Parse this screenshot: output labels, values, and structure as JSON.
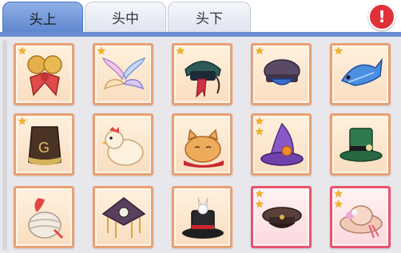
{
  "tabs": [
    {
      "label": "头上",
      "active": true
    },
    {
      "label": "头中",
      "active": false
    },
    {
      "label": "头下",
      "active": false
    }
  ],
  "alert_symbol": "!",
  "items": [
    {
      "icon": "bells-bow-icon",
      "stars": 1,
      "rarity": "normal"
    },
    {
      "icon": "angel-wings-icon",
      "stars": 1,
      "rarity": "normal"
    },
    {
      "icon": "chinese-hat-icon",
      "stars": 1,
      "rarity": "normal"
    },
    {
      "icon": "purple-cap-icon",
      "stars": 1,
      "rarity": "normal"
    },
    {
      "icon": "blue-fish-icon",
      "stars": 1,
      "rarity": "normal"
    },
    {
      "icon": "brown-fez-hat-icon",
      "stars": 1,
      "rarity": "normal"
    },
    {
      "icon": "chicken-icon",
      "stars": 0,
      "rarity": "normal"
    },
    {
      "icon": "sleeping-cat-icon",
      "stars": 0,
      "rarity": "normal"
    },
    {
      "icon": "witch-hat-icon",
      "stars": 2,
      "rarity": "normal"
    },
    {
      "icon": "green-top-hat-icon",
      "stars": 0,
      "rarity": "normal"
    },
    {
      "icon": "feather-turban-icon",
      "stars": 0,
      "rarity": "normal"
    },
    {
      "icon": "taoist-hat-icon",
      "stars": 0,
      "rarity": "normal"
    },
    {
      "icon": "bunny-top-hat-icon",
      "stars": 0,
      "rarity": "normal"
    },
    {
      "icon": "officer-cap-icon",
      "stars": 2,
      "rarity": "rare"
    },
    {
      "icon": "flower-sun-hat-icon",
      "stars": 2,
      "rarity": "rare"
    }
  ],
  "colors": {
    "tab_active": "#6c8fd2",
    "cell_border_normal": "#e8a073",
    "cell_border_rare": "#e9536c",
    "star": "#f3b31c",
    "alert": "#e0313b"
  }
}
